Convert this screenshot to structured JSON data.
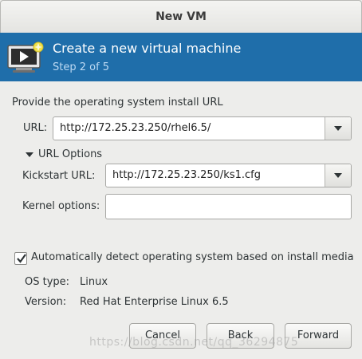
{
  "window": {
    "title": "New VM"
  },
  "header": {
    "title": "Create a new virtual machine",
    "step": "Step 2 of 5",
    "icon": "vm-monitor-icon"
  },
  "form": {
    "section_label": "Provide the operating system install URL",
    "url_label": "URL:",
    "url_value": "http://172.25.23.250/rhel6.5/",
    "url_options_label": "URL Options",
    "kickstart_label": "Kickstart URL:",
    "kickstart_value": "http://172.25.23.250/ks1.cfg",
    "kernel_label": "Kernel options:",
    "kernel_value": "",
    "autodetect_label": "Automatically detect operating system based on install media",
    "autodetect_checked": true,
    "os_type_label": "OS type:",
    "os_type_value": "Linux",
    "version_label": "Version:",
    "version_value": "Red Hat Enterprise Linux 6.5"
  },
  "buttons": {
    "cancel": "Cancel",
    "back": "Back",
    "forward": "Forward"
  },
  "watermark": "https://blog.csdn.net/qq_36294875",
  "colors": {
    "header_bg": "#1f6eaa",
    "step_text": "#bcd9f3",
    "window_bg": "#ededeb"
  }
}
